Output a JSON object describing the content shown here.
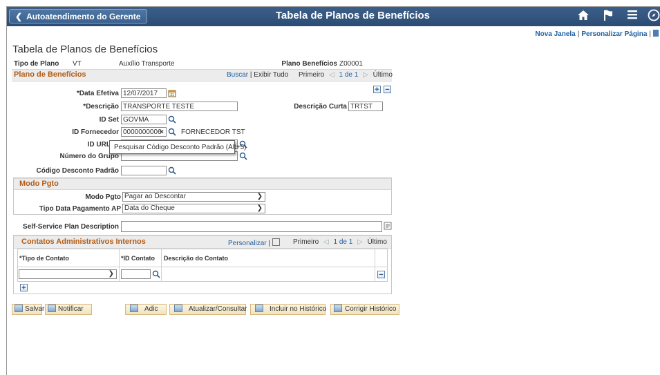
{
  "topbar": {
    "back_label": "Autoatendimento do Gerente",
    "title": "Tabela de Planos de Benefícios",
    "icons": [
      "home-icon",
      "flag-icon",
      "menu-icon",
      "compass-icon"
    ]
  },
  "links": {
    "new_window": "Nova Janela",
    "personalize_page": "Personalizar Página"
  },
  "page": {
    "title": "Tabela de Planos de Benefícios",
    "plan_type_label": "Tipo de Plano",
    "plan_type_value": "VT",
    "plan_type_desc": "Auxílio Transporte",
    "benefit_plan_label": "Plano Benefícios",
    "benefit_plan_value": "Z00001"
  },
  "plan_group": {
    "header": "Plano de Benefícios",
    "find": "Buscar",
    "view_all": "Exibir Tudo",
    "first": "Primeiro",
    "pager": "1 de 1",
    "last": "Último"
  },
  "fields": {
    "effdt_label": "*Data Efetiva",
    "effdt_value": "12/07/2017",
    "descr_label": "*Descrição",
    "descr_value": "TRANSPORTE TESTE",
    "descrshort_label": "Descrição Curta",
    "descrshort_value": "TRTST",
    "setid_label": "ID Set",
    "setid_value": "GOVMA",
    "vendor_label": "ID Fornecedor",
    "vendor_value": "0000000006",
    "vendor_clear": "×",
    "vendor_name": "FORNECEDOR TST",
    "url_label": "ID URL Pl",
    "group_label": "Número do Grupo",
    "deduction_label": "Código Desconto Padrão",
    "tooltip": "Pesquisar Código Desconto Padrão (Alt+5)"
  },
  "payment": {
    "header": "Modo Pgto",
    "mode_label": "Modo Pgto",
    "mode_value": "Pagar ao Descontar",
    "date_label": "Tipo Data Pagamento AP",
    "date_value": "Data do Cheque"
  },
  "self_service": {
    "label": "Self-Service Plan Description",
    "value": ""
  },
  "contacts": {
    "header": "Contatos Administrativos Internos",
    "personalize": "Personalizar",
    "first": "Primeiro",
    "pager": "1 de 1",
    "last": "Último",
    "columns": [
      "*Tipo de Contato",
      "*ID Contato",
      "Descrição do Contato"
    ],
    "rows": [
      {
        "type": "",
        "id": "",
        "descr": ""
      }
    ]
  },
  "toolbar": {
    "save": "Salvar",
    "notify": "Notificar",
    "add": "Adic",
    "update": "Atualizar/Consultar",
    "history": "Incluir no Histórico",
    "correct": "Corrigir Histórico"
  }
}
